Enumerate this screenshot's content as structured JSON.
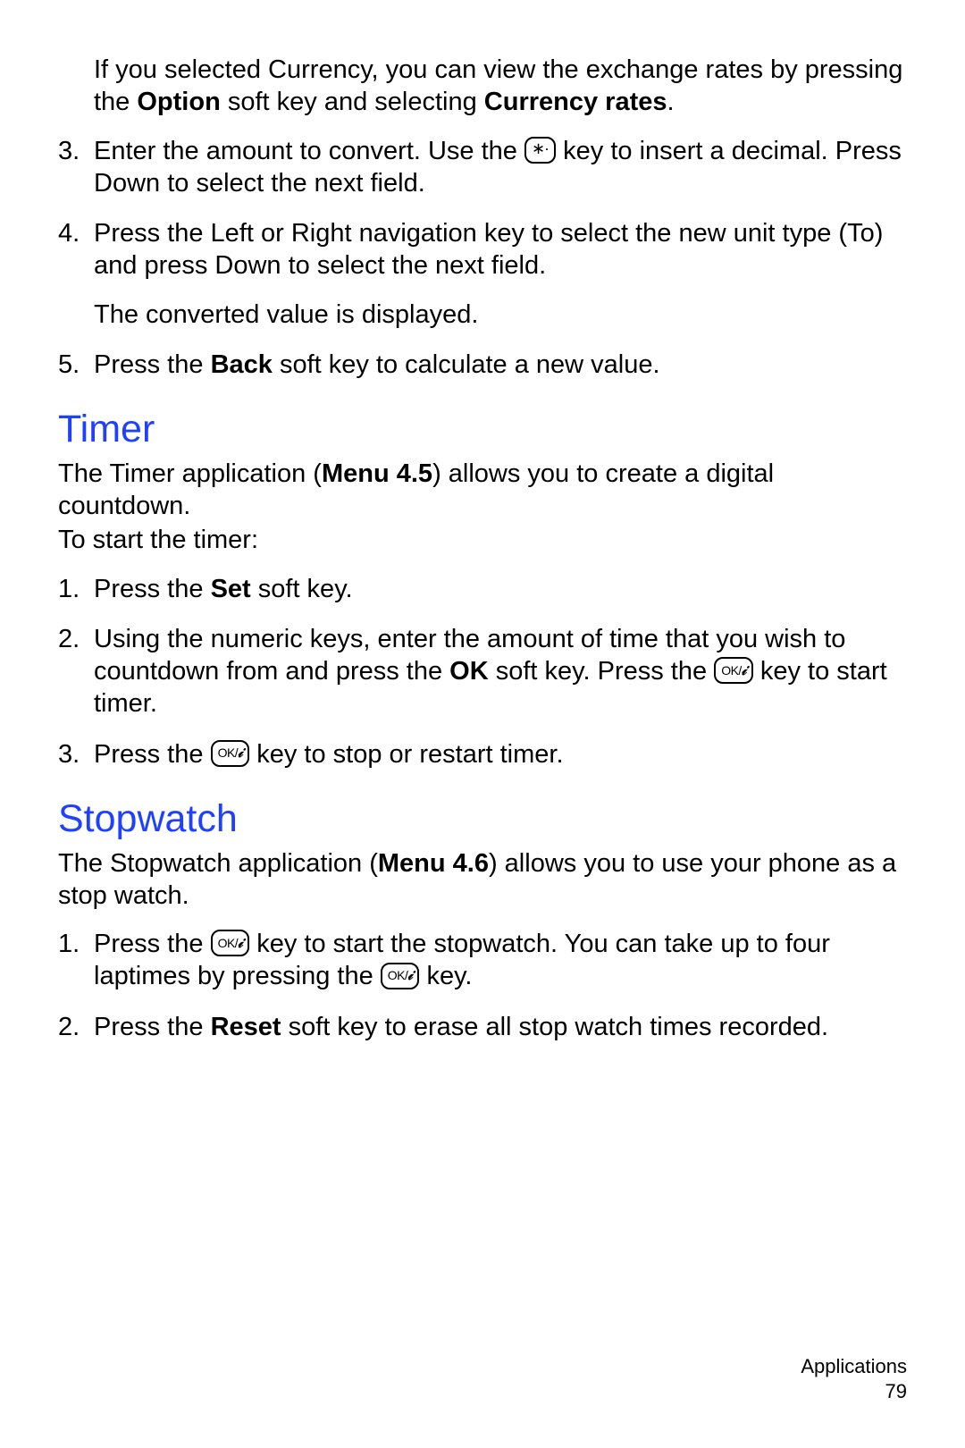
{
  "intro": {
    "note_pre": "If you selected Currency, you can view the exchange rates by pressing the ",
    "note_bold1": "Option",
    "note_mid": " soft key and selecting ",
    "note_bold2": "Currency rates",
    "note_post": "."
  },
  "conv_steps": {
    "s3_pre": "Enter the amount to convert. Use the ",
    "s3_post": " key to insert a decimal. Press Down to select the next field.",
    "s4_a": "Press the Left or Right navigation key to select the new unit type (To) and press Down to select the next field.",
    "s4_b": "The converted value is displayed.",
    "s5_pre": "Press the ",
    "s5_bold": "Back",
    "s5_post": " soft key to calculate a new value."
  },
  "timer": {
    "heading": "Timer",
    "intro_pre": "The Timer application (",
    "intro_bold": "Menu 4.5",
    "intro_post": ") allows you to create a digital countdown.",
    "start": "To start the timer:",
    "s1_pre": "Press the ",
    "s1_bold": "Set",
    "s1_post": " soft key.",
    "s2_pre": "Using the numeric keys, enter the amount of time that you wish to countdown from and press the ",
    "s2_bold": "OK",
    "s2_mid": " soft key. Press the ",
    "s2_post": " key to start timer.",
    "s3_pre": "Press the ",
    "s3_post": " key to stop or restart timer."
  },
  "stopwatch": {
    "heading": "Stopwatch",
    "intro_pre": "The Stopwatch application (",
    "intro_bold": "Menu 4.6",
    "intro_post": ") allows you to use your phone as a stop watch.",
    "s1_pre": "Press the ",
    "s1_mid": " key to start the stopwatch. You can take up to four laptimes by pressing the ",
    "s1_post": " key.",
    "s2_pre": " Press the ",
    "s2_bold": "Reset",
    "s2_post": " soft key to erase all stop watch times recorded."
  },
  "footer": {
    "section": "Applications",
    "page": "79"
  },
  "nums": {
    "n1": "1.",
    "n2": "2.",
    "n3": "3.",
    "n4": "4.",
    "n5": "5."
  }
}
